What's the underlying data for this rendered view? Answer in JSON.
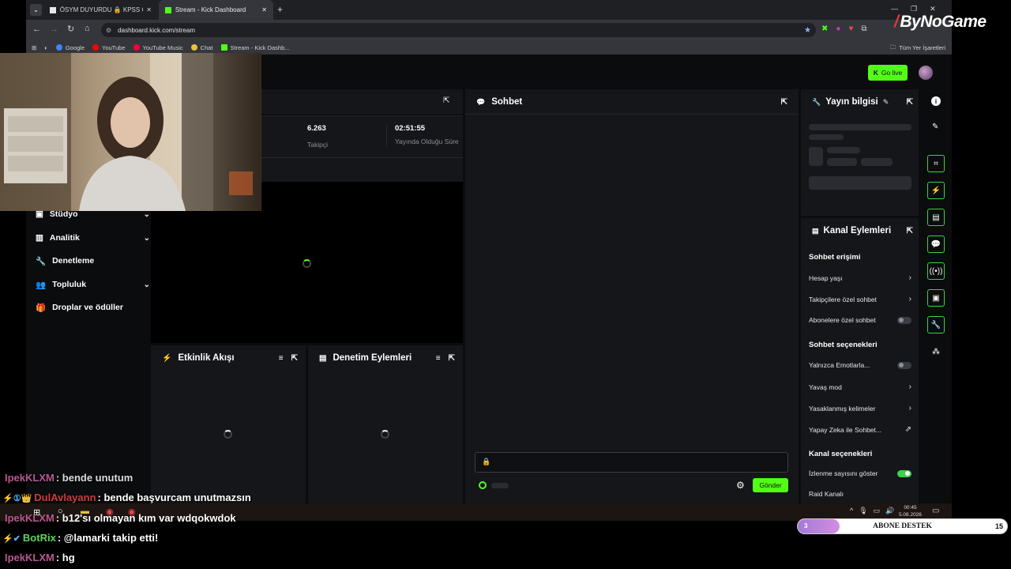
{
  "browser": {
    "tabs": [
      {
        "label": "ÖSYM DUYURDU 🔒 KPSS Orta...",
        "active": false
      },
      {
        "label": "Stream - Kick Dashboard",
        "active": true
      }
    ],
    "url": "dashboard.kick.com/stream",
    "bookmarks": [
      "Google",
      "YouTube",
      "YouTube Music",
      "Chat",
      "Stream - Kick Dashb..."
    ],
    "all_bookmarks": "Tüm Yer İşaretleri"
  },
  "brand": {
    "logo": "ByNoGame",
    "accent": "#53fc18"
  },
  "header": {
    "go_live": "Go live"
  },
  "sidebar": {
    "items": [
      {
        "label": "Stüdyo",
        "expandable": true
      },
      {
        "label": "Analitik",
        "expandable": true
      },
      {
        "label": "Denetleme",
        "expandable": false
      },
      {
        "label": "Topluluk",
        "expandable": true
      },
      {
        "label": "Droplar ve ödüller",
        "expandable": false
      }
    ]
  },
  "stats": [
    {
      "value": "6.263",
      "label": "Takipçi"
    },
    {
      "value": "02:51:55",
      "label": "Yayında Olduğu Süre"
    }
  ],
  "panels": {
    "activity": "Etkinlik Akışı",
    "moderation": "Denetim Eylemleri",
    "chat": "Sohbet",
    "stream_info": "Yayın bilgisi",
    "channel_actions": "Kanal Eylemleri"
  },
  "chat_panel": {
    "send": "Gönder"
  },
  "channel_actions": {
    "chat_access_title": "Sohbet erişimi",
    "chat_access": [
      {
        "label": "Hesap yaşı",
        "control": "chevron"
      },
      {
        "label": "Takipçilere özel sohbet",
        "control": "chevron"
      },
      {
        "label": "Abonelere özel sohbet",
        "control": "toggle-off"
      }
    ],
    "chat_options_title": "Sohbet seçenekleri",
    "chat_options": [
      {
        "label": "Yalnızca Emotlarla...",
        "control": "toggle-off"
      },
      {
        "label": "Yavaş mod",
        "control": "chevron"
      },
      {
        "label": "Yasaklanmış kelimeler",
        "control": "chevron"
      },
      {
        "label": "Yapay Zeka ile Sohbet...",
        "control": "external"
      }
    ],
    "channel_options_title": "Kanal seçenekleri",
    "channel_options": [
      {
        "label": "İzlenme sayısını göster",
        "control": "toggle-on"
      },
      {
        "label": "Raid Kanalı",
        "control": "none"
      }
    ]
  },
  "taskbar": {
    "time": "00:45",
    "date": "5.08.2026"
  },
  "overlay_chat": [
    {
      "badges": "",
      "user": "IpekKLXM",
      "user_color": "#b8588f",
      "message": ": bende unutum"
    },
    {
      "badges": "⚡①👑",
      "user": "DulAvlayann",
      "user_color": "#d23c3c",
      "message": ": bende başvurcam unutmazsın"
    },
    {
      "badges": "",
      "user": "IpekKLXM",
      "user_color": "#b8588f",
      "message": ": b12'sı olmayan kım var wdqokwdok"
    },
    {
      "badges": "⚡✔",
      "user": "BotRix",
      "user_color": "#5cd65c",
      "message": ": @lamarki takip etti!"
    },
    {
      "badges": "",
      "user": "IpekKLXM",
      "user_color": "#b8588f",
      "message": ": hg"
    }
  ],
  "goal_bar": {
    "current": "3",
    "label": "ABONE DESTEK",
    "target": "15",
    "progress": 0.2
  }
}
